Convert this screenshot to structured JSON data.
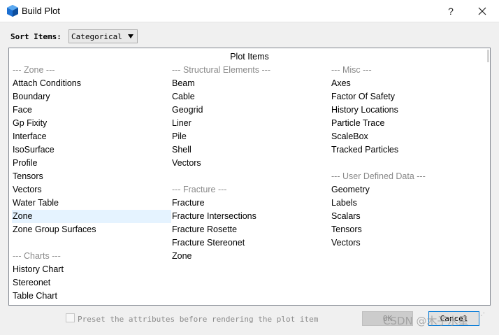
{
  "window": {
    "title": "Build Plot",
    "help_label": "?",
    "close_label": "✕"
  },
  "toolbar": {
    "sort_label": "Sort Items:",
    "sort_value": "Categorical"
  },
  "list": {
    "header": "Plot Items",
    "columns": [
      {
        "rows": [
          {
            "text": "--- Zone ---",
            "kind": "group"
          },
          {
            "text": "Attach Conditions",
            "kind": "item"
          },
          {
            "text": "Boundary",
            "kind": "item"
          },
          {
            "text": "Face",
            "kind": "item"
          },
          {
            "text": "Gp Fixity",
            "kind": "item"
          },
          {
            "text": "Interface",
            "kind": "item"
          },
          {
            "text": "IsoSurface",
            "kind": "item"
          },
          {
            "text": "Profile",
            "kind": "item"
          },
          {
            "text": "Tensors",
            "kind": "item"
          },
          {
            "text": "Vectors",
            "kind": "item"
          },
          {
            "text": "Water Table",
            "kind": "item"
          },
          {
            "text": "Zone",
            "kind": "item",
            "selected": true
          },
          {
            "text": "Zone Group Surfaces",
            "kind": "item"
          },
          {
            "text": "",
            "kind": "blank"
          },
          {
            "text": "--- Charts ---",
            "kind": "group"
          },
          {
            "text": "History Chart",
            "kind": "item"
          },
          {
            "text": "Stereonet",
            "kind": "item"
          },
          {
            "text": "Table Chart",
            "kind": "item"
          }
        ]
      },
      {
        "rows": [
          {
            "text": "--- Structural Elements ---",
            "kind": "group"
          },
          {
            "text": "Beam",
            "kind": "item"
          },
          {
            "text": "Cable",
            "kind": "item"
          },
          {
            "text": "Geogrid",
            "kind": "item"
          },
          {
            "text": "Liner",
            "kind": "item"
          },
          {
            "text": "Pile",
            "kind": "item"
          },
          {
            "text": "Shell",
            "kind": "item"
          },
          {
            "text": "Vectors",
            "kind": "item"
          },
          {
            "text": "",
            "kind": "blank"
          },
          {
            "text": "--- Fracture ---",
            "kind": "group"
          },
          {
            "text": "Fracture",
            "kind": "item"
          },
          {
            "text": "Fracture Intersections",
            "kind": "item"
          },
          {
            "text": "Fracture Rosette",
            "kind": "item"
          },
          {
            "text": "Fracture Stereonet",
            "kind": "item"
          },
          {
            "text": "Zone",
            "kind": "item"
          }
        ]
      },
      {
        "rows": [
          {
            "text": "--- Misc ---",
            "kind": "group"
          },
          {
            "text": "Axes",
            "kind": "item"
          },
          {
            "text": "Factor Of Safety",
            "kind": "item"
          },
          {
            "text": "History Locations",
            "kind": "item"
          },
          {
            "text": "Particle Trace",
            "kind": "item"
          },
          {
            "text": "ScaleBox",
            "kind": "item"
          },
          {
            "text": "Tracked Particles",
            "kind": "item"
          },
          {
            "text": "",
            "kind": "blank"
          },
          {
            "text": "--- User Defined Data ---",
            "kind": "group"
          },
          {
            "text": "Geometry",
            "kind": "item"
          },
          {
            "text": "Labels",
            "kind": "item"
          },
          {
            "text": "Scalars",
            "kind": "item"
          },
          {
            "text": "Tensors",
            "kind": "item"
          },
          {
            "text": "Vectors",
            "kind": "item"
          }
        ]
      }
    ]
  },
  "footer": {
    "preset_label": "Preset the attributes before rendering the plot item",
    "preset_checked": false,
    "ok_label": "OK",
    "cancel_label": "Cancel",
    "watermark": "CSDN @木子水星"
  },
  "colors": {
    "group_text": "#8a8a8a",
    "selected_row": "#e5f3ff",
    "cancel_focus_border": "#0078d7",
    "disabled_button": "#cccccc"
  }
}
